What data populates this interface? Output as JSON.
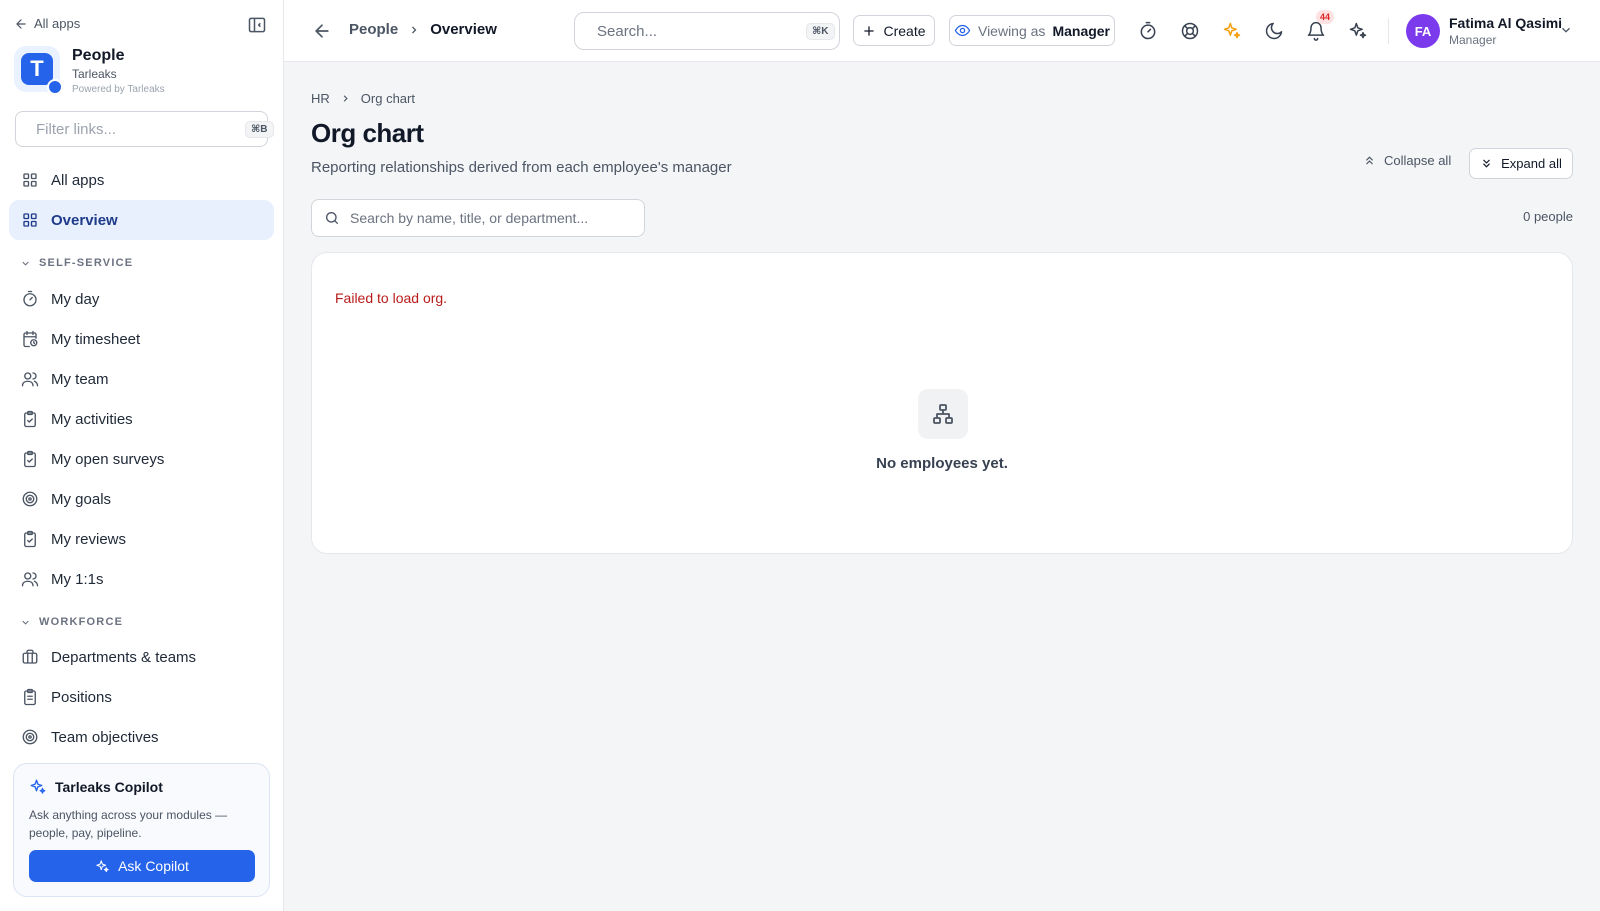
{
  "sidebar": {
    "all_apps_label": "All apps",
    "brand": {
      "logo_letter": "T",
      "name": "People",
      "org": "Tarleaks",
      "powered_by": "Powered by Tarleaks"
    },
    "filter": {
      "placeholder": "Filter links...",
      "shortcut": "⌘B"
    },
    "top_items": [
      {
        "label": "All apps",
        "icon": "grid-icon"
      },
      {
        "label": "Overview",
        "icon": "grid-icon",
        "active": true
      }
    ],
    "sections": [
      {
        "title": "SELF-SERVICE",
        "items": [
          {
            "label": "My day",
            "icon": "timer-icon"
          },
          {
            "label": "My timesheet",
            "icon": "calendar-clock-icon"
          },
          {
            "label": "My team",
            "icon": "users-icon"
          },
          {
            "label": "My activities",
            "icon": "clipboard-check-icon"
          },
          {
            "label": "My open surveys",
            "icon": "clipboard-check-icon"
          },
          {
            "label": "My goals",
            "icon": "target-icon"
          },
          {
            "label": "My reviews",
            "icon": "clipboard-check-icon"
          },
          {
            "label": "My 1:1s",
            "icon": "users-icon"
          }
        ]
      },
      {
        "title": "WORKFORCE",
        "items": [
          {
            "label": "Departments & teams",
            "icon": "briefcase-icon"
          },
          {
            "label": "Positions",
            "icon": "clipboard-list-icon"
          },
          {
            "label": "Team objectives",
            "icon": "target-icon"
          }
        ]
      }
    ],
    "copilot": {
      "title": "Tarleaks Copilot",
      "description": "Ask anything across your modules — people, pay, pipeline.",
      "button_label": "Ask Copilot"
    }
  },
  "topbar": {
    "breadcrumb": [
      "People",
      "Overview"
    ],
    "search": {
      "placeholder": "Search...",
      "shortcut": "⌘K"
    },
    "create_label": "Create",
    "viewing": {
      "prefix": "Viewing as",
      "role": "Manager"
    },
    "notification_count": "44",
    "user": {
      "initials": "FA",
      "name": "Fatima Al Qasimi",
      "role": "Manager"
    }
  },
  "main": {
    "breadcrumb": [
      "HR",
      "Org chart"
    ],
    "title": "Org chart",
    "subtitle": "Reporting relationships derived from each employee's manager",
    "collapse_all_label": "Collapse all",
    "expand_all_label": "Expand all",
    "search_placeholder": "Search by name, title, or department...",
    "people_count": "0 people",
    "error_message": "Failed to load org.",
    "empty_message": "No employees yet."
  },
  "colors": {
    "accent": "#2563eb",
    "active_bg": "#e8f0fd",
    "error": "#b91c1c",
    "avatar": "#7c3aed",
    "sparkle": "#f59e0b"
  }
}
